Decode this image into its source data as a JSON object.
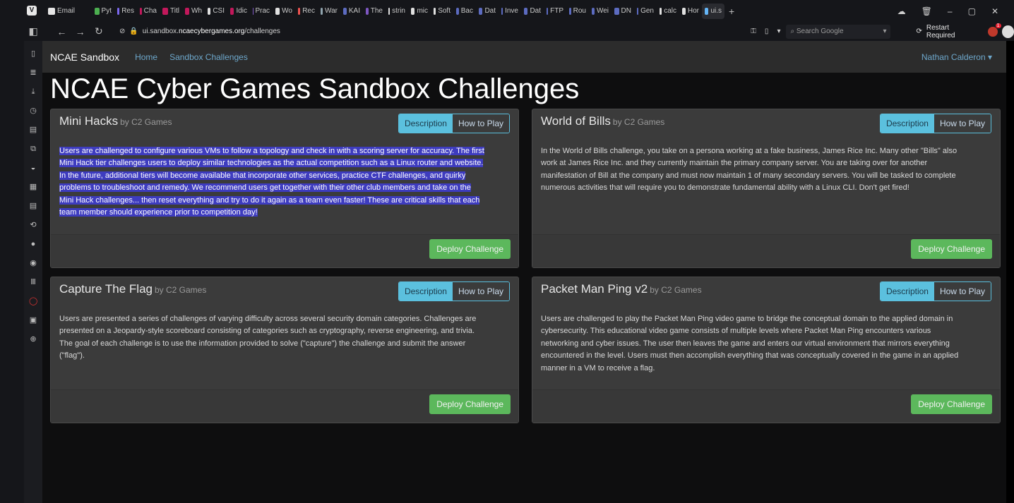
{
  "browser": {
    "tabs": [
      {
        "label": "Email",
        "color": "#e6e6e6"
      },
      {
        "label": "Pyt",
        "color": "#4caf50"
      },
      {
        "label": "Res",
        "color": "#7b68ee"
      },
      {
        "label": "Cha",
        "color": "#c2185b"
      },
      {
        "label": "Titl",
        "color": "#c2185b"
      },
      {
        "label": "Wh",
        "color": "#c2185b"
      },
      {
        "label": "CSI",
        "color": "#e0e0e0"
      },
      {
        "label": "Idic",
        "color": "#c2185b"
      },
      {
        "label": "Prac",
        "color": "#7e57c2"
      },
      {
        "label": "Wo",
        "color": "#e0e0e0"
      },
      {
        "label": "Rec",
        "color": "#ef5350"
      },
      {
        "label": "War",
        "color": "#90a4ae"
      },
      {
        "label": "KAI",
        "color": "#5c6bc0"
      },
      {
        "label": "The",
        "color": "#7e57c2"
      },
      {
        "label": "strin",
        "color": "#e0e0e0"
      },
      {
        "label": "mic",
        "color": "#e0e0e0"
      },
      {
        "label": "Soft",
        "color": "#e0e0e0"
      },
      {
        "label": "Bac",
        "color": "#5c6bc0"
      },
      {
        "label": "Dat",
        "color": "#5c6bc0"
      },
      {
        "label": "Inve",
        "color": "#5c6bc0"
      },
      {
        "label": "Dat",
        "color": "#5c6bc0"
      },
      {
        "label": "FTP",
        "color": "#5c6bc0"
      },
      {
        "label": "Rou",
        "color": "#5c6bc0"
      },
      {
        "label": "Wei",
        "color": "#5c6bc0"
      },
      {
        "label": "DN",
        "color": "#5c6bc0"
      },
      {
        "label": "Gen",
        "color": "#5c6bc0"
      },
      {
        "label": "calc",
        "color": "#e0e0e0"
      },
      {
        "label": "Hor",
        "color": "#e0e0e0"
      },
      {
        "label": "ui.s",
        "color": "#64b5f6"
      }
    ],
    "url_prefix": "ui.sandbox.",
    "url_host": "ncaecybergames.org",
    "url_path": "/challenges",
    "search_placeholder": "Search Google",
    "restart_label": "Restart Required",
    "ext_badge_count": "1"
  },
  "navbar": {
    "brand": "NCAE Sandbox",
    "links": [
      "Home",
      "Sandbox Challenges"
    ],
    "user": "Nathan Calderon"
  },
  "page_title": "NCAE Cyber Games Sandbox Challenges",
  "cards": [
    {
      "title": "Mini Hacks",
      "author": "by C2 Games",
      "desc_label": "Description",
      "how_label": "How to Play",
      "deploy_label": "Deploy Challenge",
      "body_lines": [
        "Users are challenged to configure various VMs to follow a topology and check in with a scoring server for accuracy. The first",
        "Mini Hack tier challenges users to deploy similar technologies as the actual competition such as a Linux router and website.",
        "In the future, additional tiers will become available that incorporate other services, practice CTF challenges, and quirky",
        "problems to troubleshoot and remedy. We recommend users get together with their other club members and take on the",
        "Mini Hack challenges... then reset everything and try to do it again as a team even faster! These are critical skills that each",
        "team member should experience prior to competition day!"
      ]
    },
    {
      "title": "World of Bills",
      "author": "by C2 Games",
      "desc_label": "Description",
      "how_label": "How to Play",
      "deploy_label": "Deploy Challenge",
      "body_lines": [
        "In the World of Bills challenge, you take on a persona working at a fake business, James Rice Inc. Many other \"Bills\" also",
        "work at James Rice Inc. and they currently maintain the primary company server. You are taking over for another",
        "manifestation of Bill at the company and must now maintain 1 of many secondary servers. You will be tasked to complete",
        "numerous activities that will require you to demonstrate fundamental ability with a Linux CLI. Don't get fired!"
      ]
    },
    {
      "title": "Capture The Flag",
      "author": "by C2 Games",
      "desc_label": "Description",
      "how_label": "How to Play",
      "deploy_label": "Deploy Challenge",
      "body_lines": [
        "Users are presented a series of challenges of varying difficulty across several security domain categories. Challenges are",
        "presented on a Jeopardy-style scoreboard consisting of categories such as cryptography, reverse engineering, and trivia.",
        "The goal of each challenge is to use the information provided to solve (\"capture\") the challenge and submit the answer",
        "(\"flag\")."
      ]
    },
    {
      "title": "Packet Man Ping v2",
      "author": "by C2 Games",
      "desc_label": "Description",
      "how_label": "How to Play",
      "deploy_label": "Deploy Challenge",
      "body_lines": [
        "Users are challenged to play the Packet Man Ping video game to bridge the conceptual domain to the applied domain in",
        "cybersecurity. This educational video game consists of multiple levels where Packet Man Ping encounters various",
        "networking and cyber issues. The user then leaves the game and enters our virtual environment that mirrors everything",
        "encountered in the level. Users must then accomplish everything that was conceptually covered in the game in an applied",
        "manner in a VM to receive a flag."
      ]
    }
  ]
}
